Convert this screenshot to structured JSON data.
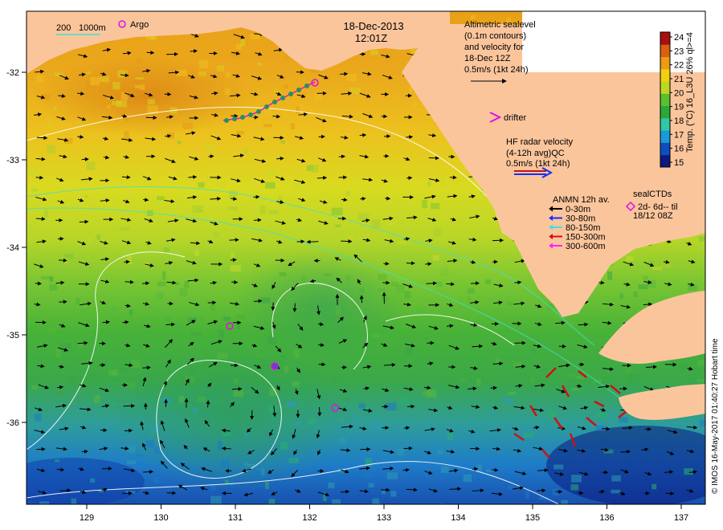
{
  "header": {
    "date": "18-Dec-2013",
    "time": "12:01Z"
  },
  "contours": {
    "label_200": "200",
    "label_1000": "1000m",
    "color": "#40e0d0"
  },
  "argo": {
    "label": "Argo",
    "color": "#e010e0"
  },
  "altimetry": {
    "lines": [
      "Altimetric sealevel",
      "(0.1m contours)",
      "and velocity for",
      "18-Dec 12Z",
      "0.5m/s (1kt 24h)"
    ]
  },
  "drifter": {
    "label": "drifter",
    "color": "#e010e0"
  },
  "hf_radar": {
    "lines": [
      "HF radar velocity",
      "(4-12h avg)QC",
      "0.5m/s (1kt 24h)"
    ]
  },
  "anmn": {
    "title": "ANMN 12h av.",
    "items": [
      {
        "label": "0-30m",
        "color": "#000000"
      },
      {
        "label": "30-80m",
        "color": "#1030ff"
      },
      {
        "label": "80-150m",
        "color": "#40e0e0"
      },
      {
        "label": "150-300m",
        "color": "#d01010"
      },
      {
        "label": "300-600m",
        "color": "#ff20ff"
      }
    ]
  },
  "sealctds": {
    "lines": [
      "sealCTDs",
      "2d- 6d-- til",
      "18/12 08Z"
    ],
    "color": "#e010e0"
  },
  "colorbar": {
    "label": "Temp. (°C) 16_L3U 26% ql>=4",
    "min": 15,
    "max": 24,
    "ticks": [
      "15",
      "16",
      "17",
      "18",
      "19",
      "20",
      "21",
      "22",
      "23",
      "24"
    ],
    "colors": [
      "#0a1a80",
      "#0d4fc0",
      "#1a9ad8",
      "#30c8a8",
      "#2aa838",
      "#5ac030",
      "#bcd820",
      "#f0d010",
      "#ef9a12",
      "#d86010",
      "#a81010"
    ]
  },
  "axes": {
    "x_ticks": [
      "129",
      "130",
      "131",
      "132",
      "133",
      "134",
      "135",
      "136",
      "137"
    ],
    "y_ticks": [
      "-32",
      "-33",
      "-34",
      "-35",
      "-36"
    ]
  },
  "credit": "© IMOS 16-May-2017 01:40:27 Hobart time",
  "colors": {
    "land": "#fbc59c",
    "frame": "#000000",
    "altimetry_contour": "#ffffff",
    "hf_radar_arrow_1": "#d01010",
    "hf_radar_arrow_2": "#1030ff"
  }
}
